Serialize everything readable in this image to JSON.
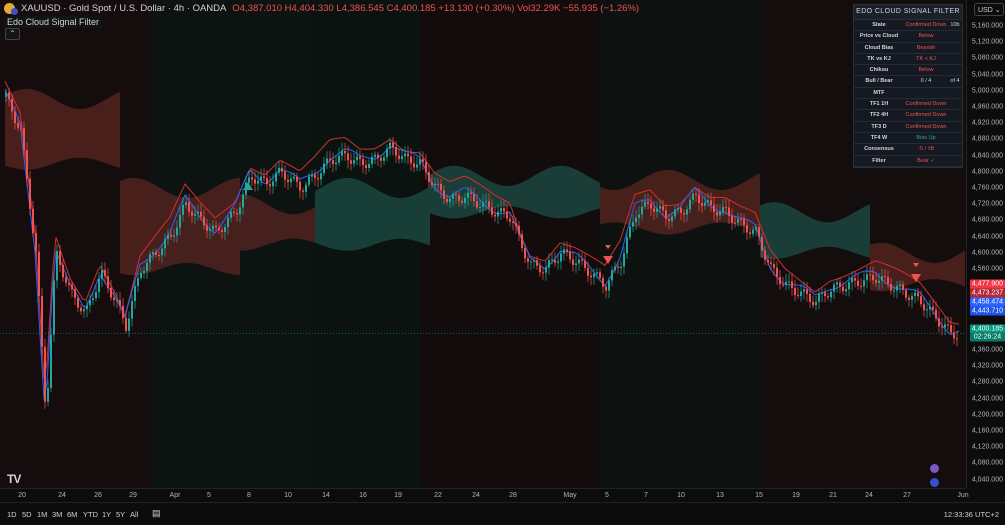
{
  "header": {
    "symbol": "XAUUSD · Gold Spot / U.S. Dollar · 4h · OANDA",
    "ohlc": "O4,387.010 H4,404.330 L4,386.545 C4,400.185 +13.130 (+0.30%) Vol32.29K −55.935 (−1.26%)"
  },
  "indicator": {
    "name": "Edo Cloud Signal Filter",
    "collapse_icon": "chevron-up-icon"
  },
  "panel": {
    "title": "EDO CLOUD SIGNAL FILTER",
    "rows": [
      {
        "label": "State",
        "value": "Confirmed Down",
        "extra": "10b",
        "color": "#ef5350"
      },
      {
        "label": "Price vs Cloud",
        "value": "Below",
        "extra": "",
        "color": "#ef5350"
      },
      {
        "label": "Cloud Bias",
        "value": "Bearish",
        "extra": "",
        "color": "#ef5350"
      },
      {
        "label": "TK vs KJ",
        "value": "TK < KJ",
        "extra": "",
        "color": "#ef5350"
      },
      {
        "label": "Chikou",
        "value": "Below",
        "extra": "",
        "color": "#ef5350"
      },
      {
        "label": "Bull / Bear",
        "value": "0 / 4",
        "extra": "of 4",
        "color": "#d1d4dc"
      },
      {
        "label": "MTF",
        "value": "",
        "extra": "",
        "color": "#d1d4dc"
      },
      {
        "label": "TF1 1H",
        "value": "Confirmed Down",
        "extra": "",
        "color": "#ef5350"
      },
      {
        "label": "TF2 4H",
        "value": "Confirmed Down",
        "extra": "",
        "color": "#ef5350"
      },
      {
        "label": "TF3 D",
        "value": "Confirmed Down",
        "extra": "",
        "color": "#ef5350"
      },
      {
        "label": "TF4 W",
        "value": "Bias Up",
        "extra": "",
        "color": "#26a69a"
      },
      {
        "label": "Consensus",
        "value": "-5 / ±8",
        "extra": "",
        "color": "#ef5350"
      },
      {
        "label": "Filter",
        "value": "Bear ✓",
        "extra": "",
        "color": "#ef5350"
      }
    ]
  },
  "price_axis": {
    "currency": "USD",
    "ticks": [
      "5,160.000",
      "5,120.000",
      "5,080.000",
      "5,040.000",
      "5,000.000",
      "4,960.000",
      "4,920.000",
      "4,880.000",
      "4,840.000",
      "4,800.000",
      "4,760.000",
      "4,720.000",
      "4,680.000",
      "4,640.000",
      "4,600.000",
      "4,560.000",
      "4,520.000",
      "4,480.000",
      "4,360.000",
      "4,320.000",
      "4,280.000",
      "4,240.000",
      "4,200.000",
      "4,160.000",
      "4,120.000",
      "4,080.000",
      "4,040.000"
    ],
    "tags": [
      {
        "label": "4,477.900",
        "color": "#f23645"
      },
      {
        "label": "4,473.237",
        "color": "#b22833"
      },
      {
        "label": "4,458.474",
        "color": "#2962ff"
      },
      {
        "label": "4,443.710",
        "color": "#1e53e5"
      },
      {
        "label": "4,400.185",
        "color": "#089981"
      },
      {
        "label": "02:26:24",
        "color": "#067a66"
      }
    ]
  },
  "time_axis": {
    "ticks": [
      "20",
      "24",
      "26",
      "29",
      "Apr",
      "5",
      "8",
      "10",
      "14",
      "16",
      "19",
      "22",
      "24",
      "28",
      "May",
      "5",
      "7",
      "10",
      "13",
      "15",
      "19",
      "21",
      "24",
      "27",
      "Jun"
    ]
  },
  "toolbar": {
    "timeframes": [
      "1D",
      "5D",
      "1M",
      "3M",
      "6M",
      "YTD",
      "1Y",
      "5Y",
      "All"
    ],
    "calendar_icon": "calendar-range-icon",
    "clock": "12:33:36 UTC+2"
  },
  "logo": "TV",
  "colors": {
    "up": "#26a69a",
    "down": "#ef5350",
    "kijun": "#d32f2f",
    "tenkan": "#2962ff",
    "cloud_bull": "#1d4d45",
    "cloud_bear": "#5a2520"
  },
  "chart_data": {
    "type": "candlestick",
    "symbol_price_range": [
      4040,
      5160
    ],
    "last_close": 4400.185,
    "signals": [
      {
        "x_label": "8",
        "direction": "up"
      },
      {
        "x_label": "5",
        "direction": "down"
      },
      {
        "x_label": "27",
        "direction": "down"
      }
    ]
  }
}
